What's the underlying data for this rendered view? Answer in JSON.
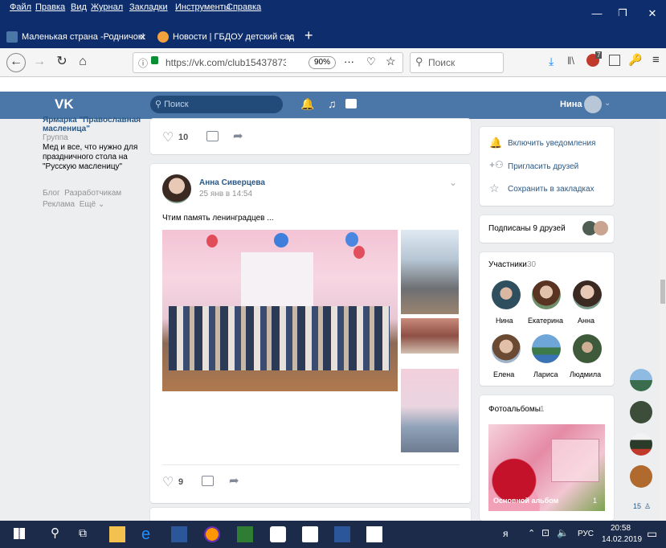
{
  "menubar": {
    "items": [
      "Файл",
      "Правка",
      "Вид",
      "Журнал",
      "Закладки",
      "Инструменты",
      "Справка"
    ],
    "minimize": "—",
    "maximize": "❐",
    "close": "✕"
  },
  "tabs": [
    {
      "title": "Маленькая страна -Родничок!",
      "close": "✕"
    },
    {
      "title": "Новости | ГБДОУ детский сад",
      "close": "✕"
    }
  ],
  "new_tab": "+",
  "nav": {
    "url": "https://vk.com/club15437873",
    "zoom": "90%",
    "more": "···",
    "search_placeholder": "Поиск",
    "badge": "7"
  },
  "vk": {
    "logo": "VK",
    "search_placeholder": "Поиск",
    "user_name": "Нина"
  },
  "left": {
    "group_title": "Ярмарка \"Православная масленица\"",
    "group_type": "Группа",
    "group_desc": "Мед и все, что нужно для праздничного стола на \"Русскую масленицу\"",
    "footer_links": [
      "Блог",
      "Разработчикам",
      "Реклама",
      "Ещё"
    ]
  },
  "post1": {
    "likes": "10"
  },
  "post2": {
    "author": "Анна Сиверцева",
    "date": "25 янв в 14:54",
    "text": "Чтим память ленинградцев ...",
    "likes": "9"
  },
  "sidebar": {
    "actions": [
      "Включить уведомления",
      "Пригласить друзей",
      "Сохранить в закладках"
    ],
    "friends_label": "Подписаны 9 друзей",
    "members_label": "Участники",
    "members_count": "30",
    "members": [
      "Нина",
      "Екатерина",
      "Анна",
      "Елена",
      "Лариса",
      "Людмила"
    ],
    "albums_label": "Фотоальбомы",
    "albums_count": "1",
    "album_title": "Основной альбом",
    "album_count": "1",
    "online_count": "15"
  },
  "taskbar": {
    "lang": "РУС",
    "time": "20:58",
    "date": "14.02.2019"
  }
}
